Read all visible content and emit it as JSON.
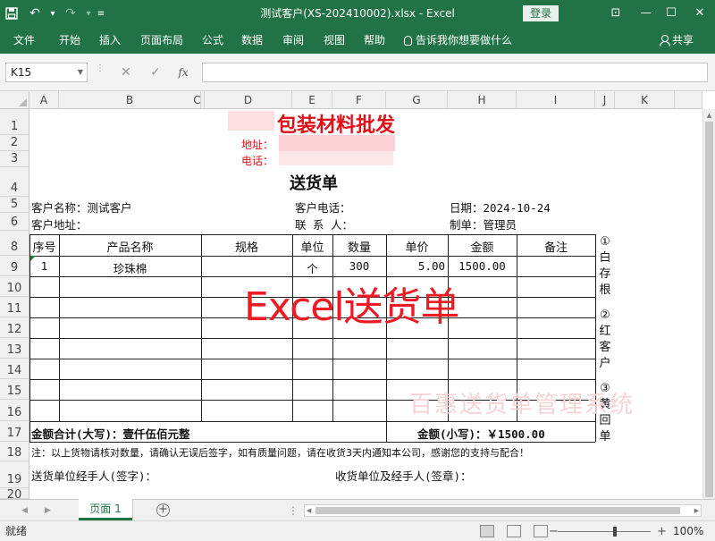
{
  "window": {
    "title": "测试客户(XS-202410002).xlsx  -  Excel",
    "login_label": "登录",
    "controls": {
      "minimize": "—",
      "restore": "☐",
      "close": "✕"
    }
  },
  "qat": {
    "save_icon": "save-icon",
    "undo_icon": "undo-icon",
    "redo_icon": "redo-icon",
    "customize_icon": "customize-icon"
  },
  "ribbon": {
    "tabs": [
      "文件",
      "开始",
      "插入",
      "页面布局",
      "公式",
      "数据",
      "审阅",
      "视图",
      "帮助"
    ],
    "tell_me": "告诉我你想要做什么",
    "share": "共享"
  },
  "formula_bar": {
    "name_box": "K15",
    "formula": "",
    "fx_label": "fx"
  },
  "columns": [
    "A",
    "B",
    "C",
    "D",
    "E",
    "F",
    "G",
    "H",
    "I",
    "J",
    "K"
  ],
  "rows": [
    "1",
    "2",
    "3",
    "4",
    "5",
    "6",
    "8",
    "9",
    "10",
    "11",
    "12",
    "13",
    "14",
    "15",
    "16",
    "17",
    "18",
    "19",
    "20"
  ],
  "sheet": {
    "company_name": "包装材料批发",
    "address_label": "地址：",
    "phone_label": "电话：",
    "doc_title": "送货单",
    "customer_name_label": "客户名称：测试客户",
    "customer_phone_label": "客户电话：",
    "date_label": "日期：2024-10-24",
    "customer_address_label": "客户地址：",
    "contact_label": "联 系 人：",
    "maker_label": "制单：管理员",
    "table_headers": [
      "序号",
      "产品名称",
      "规格",
      "单位",
      "数量",
      "单价",
      "金额",
      "备注"
    ],
    "items": [
      {
        "no": "1",
        "name": "珍珠棉",
        "spec": "",
        "unit": "个",
        "qty": "300",
        "price": "5.00",
        "amount": "1500.00",
        "note": ""
      }
    ],
    "total_upper_label": "金额合计(大写)：壹仟伍佰元整",
    "total_lower_label": "金额(小写)：￥1500.00",
    "note": "注：以上货物请核对数量，请确认无误后签字，如有质量问题，请在收货3天内通知本公司，感谢您的支持与配合！",
    "sender_sign": "送货单位经手人(签字)：",
    "receiver_sign": "收货单位及经手人(签章)：",
    "side_notes": [
      "①",
      "白",
      "存",
      "根",
      "②",
      "红",
      "客",
      "户",
      "③",
      "黄",
      "回",
      "单"
    ],
    "watermark_main": "Excel送货单",
    "watermark_faint": "百惠送货单管理系统"
  },
  "sheet_tabs": {
    "active": "页面 1",
    "add_icon": "add-sheet-icon"
  },
  "status": {
    "ready": "就绪",
    "zoom": "100%"
  }
}
